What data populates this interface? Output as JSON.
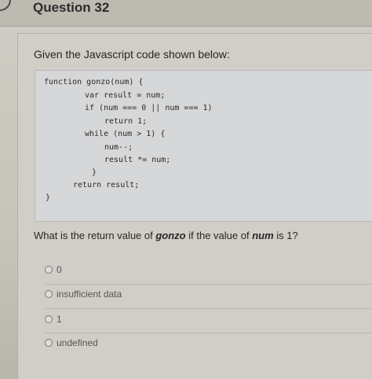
{
  "header": {
    "question_title": "Question 32"
  },
  "prompt": "Given the Javascript code shown below:",
  "code_lines": [
    "function gonzo(num) {",
    "var result = num;",
    "if (num === 0 || num === 1)",
    "return 1;",
    "while (num > 1) {",
    "num--;",
    "result *= num;",
    "}",
    "return result;",
    "}"
  ],
  "question": {
    "prefix": "What is the return value of ",
    "func_name": "gonzo",
    "middle": " if the value of ",
    "var_name": "num",
    "suffix": " is 1?"
  },
  "options": [
    {
      "label": "0"
    },
    {
      "label": "insufficient data"
    },
    {
      "label": "1"
    },
    {
      "label": "undefined"
    }
  ]
}
